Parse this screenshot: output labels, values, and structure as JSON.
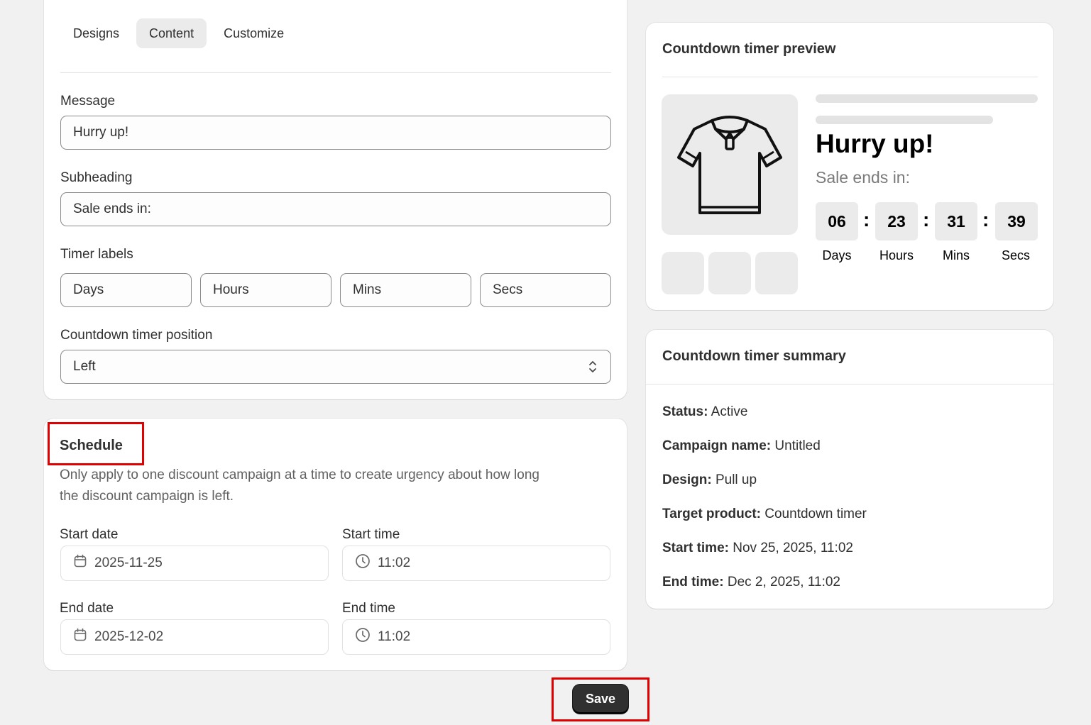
{
  "tabs": [
    "Designs",
    "Content",
    "Customize"
  ],
  "active_tab": "Content",
  "form": {
    "message_label": "Message",
    "message_value": "Hurry up!",
    "subheading_label": "Subheading",
    "subheading_value": "Sale ends in:",
    "timer_labels_label": "Timer labels",
    "timer_labels": [
      "Days",
      "Hours",
      "Mins",
      "Secs"
    ],
    "position_label": "Countdown timer position",
    "position_value": "Left"
  },
  "schedule": {
    "title": "Schedule",
    "description_line1": "Only apply to one discount campaign at a time to create urgency about how long",
    "description_line2": "the discount campaign is left.",
    "start_date_label": "Start date",
    "start_date": "2025-11-25",
    "start_time_label": "Start time",
    "start_time": "11:02",
    "end_date_label": "End date",
    "end_date": "2025-12-02",
    "end_time_label": "End time",
    "end_time": "11:02"
  },
  "save_label": "Save",
  "preview": {
    "title": "Countdown timer preview",
    "headline": "Hurry up!",
    "subheading": "Sale ends in:",
    "values": [
      "06",
      "23",
      "31",
      "39"
    ],
    "labels": [
      "Days",
      "Hours",
      "Mins",
      "Secs"
    ],
    "separator": ":"
  },
  "summary": {
    "title": "Countdown timer summary",
    "rows": [
      {
        "key": "Status:",
        "value": "Active"
      },
      {
        "key": "Campaign name:",
        "value": "Untitled"
      },
      {
        "key": "Design:",
        "value": "Pull up"
      },
      {
        "key": "Target product:",
        "value": "Countdown timer"
      },
      {
        "key": "Start time:",
        "value": "Nov 25, 2025, 11:02"
      },
      {
        "key": "End time:",
        "value": "Dec 2, 2025, 11:02"
      }
    ]
  },
  "colors": {
    "highlight": "#e00000",
    "primary_button": "#303030",
    "page_bg": "#f1f1f1"
  }
}
